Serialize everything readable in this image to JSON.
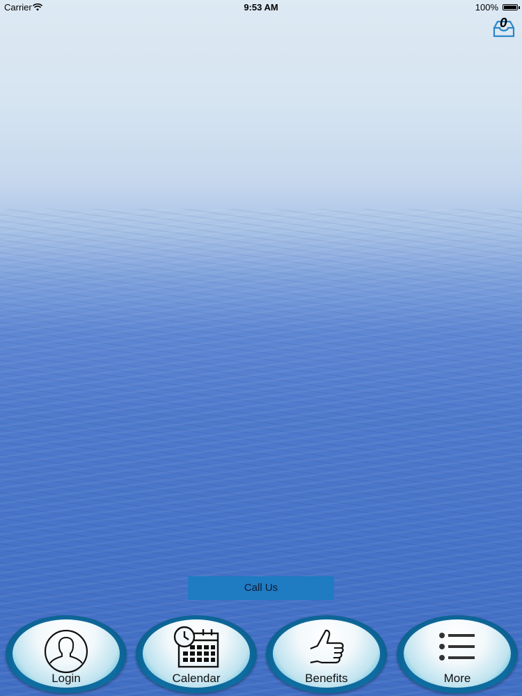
{
  "status_bar": {
    "carrier": "Carrier",
    "time": "9:53 AM",
    "battery": "100%"
  },
  "inbox": {
    "count": "0",
    "icon": "inbox-icon"
  },
  "call_button": {
    "label": "Call Us",
    "color": "#1f7bc2"
  },
  "tabs": [
    {
      "label": "Login",
      "icon": "user-icon"
    },
    {
      "label": "Calendar",
      "icon": "calendar-clock-icon"
    },
    {
      "label": "Benefits",
      "icon": "thumbs-up-icon"
    },
    {
      "label": "More",
      "icon": "list-icon"
    }
  ]
}
